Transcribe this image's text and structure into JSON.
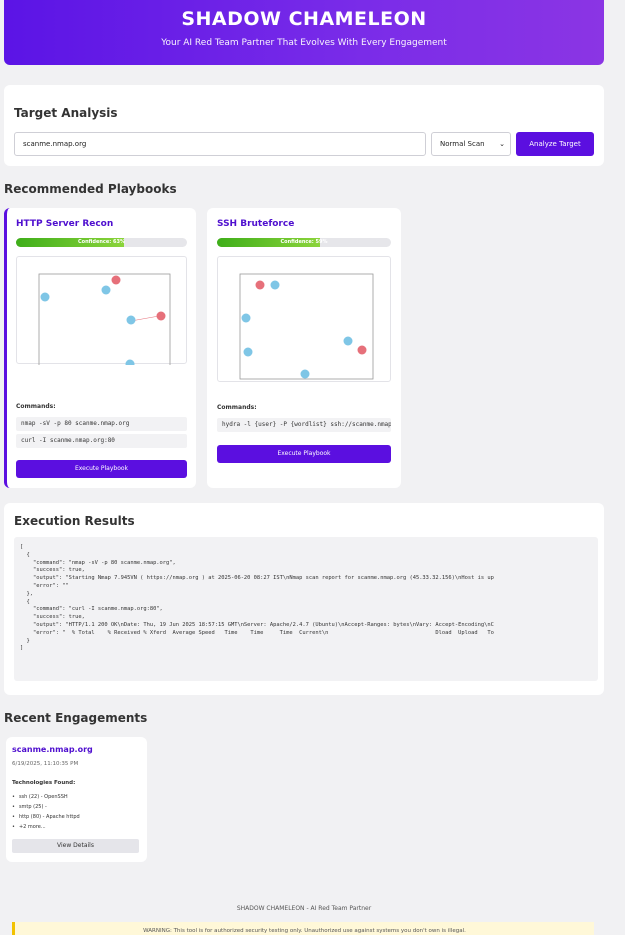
{
  "header": {
    "title": "SHADOW CHAMELEON",
    "subtitle": "Your AI Red Team Partner That Evolves With Every Engagement"
  },
  "target_analysis": {
    "title": "Target Analysis",
    "input_value": "scanme.nmap.org",
    "scan_type": "Normal Scan",
    "analyze_button": "Analyze Target"
  },
  "playbooks": {
    "title": "Recommended Playbooks",
    "items": [
      {
        "name": "HTTP Server Recon",
        "confidence_text": "Confidence: 63%",
        "confidence": 0.63,
        "commands_label": "Commands:",
        "commands": [
          "nmap -sV -p 80 scanme.nmap.org",
          "curl -I scanme.nmap.org:80"
        ],
        "button": "Execute Playbook"
      },
      {
        "name": "SSH Bruteforce",
        "confidence_text": "Confidence: 59%",
        "confidence": 0.59,
        "commands_label": "Commands:",
        "commands": [
          "hydra -l {user} -P {wordlist} ssh://scanme.nmap.org"
        ],
        "button": "Execute Playbook"
      }
    ]
  },
  "results": {
    "title": "Execution Results",
    "lines": [
      "[",
      "  {",
      "    \"command\": \"nmap -sV -p 80 scanme.nmap.org\",",
      "    \"success\": true,",
      "    \"output\": \"Starting Nmap 7.945VN ( https://nmap.org ) at 2025-06-20 08:27 IST\\nNmap scan report for scanme.nmap.org (45.33.32.156)\\nHost is up",
      "    \"error\": \"\"",
      "  },",
      "  {",
      "    \"command\": \"curl -I scanme.nmap.org:80\",",
      "    \"success\": true,",
      "    \"output\": \"HTTP/1.1 200 OK\\nDate: Thu, 19 Jun 2025 18:57:15 GMT\\nServer: Apache/2.4.7 (Ubuntu)\\nAccept-Ranges: bytes\\nVary: Accept-Encoding\\nC",
      "    \"error\": \"  % Total    % Received % Xferd  Average Speed   Time    Time     Time  Current\\n                                 Dload  Upload   To",
      "  }",
      "]"
    ]
  },
  "recent": {
    "title": "Recent Engagements",
    "engagement": {
      "host": "scanme.nmap.org",
      "date": "6/19/2025, 11:10:35 PM",
      "tech_label": "Technologies Found:",
      "technologies": [
        "ssh (22) - OpenSSH",
        "smtp (25) -",
        "http (80) - Apache httpd",
        "+2 more..."
      ],
      "button": "View Details"
    }
  },
  "footer": {
    "text": "SHADOW CHAMELEON - AI Red Team Partner",
    "warning": "WARNING: This tool is for authorized security testing only. Unauthorized use against systems you don't own is illegal."
  },
  "colors": {
    "brand": "#5b0fe0",
    "node_blue": "#7fc6e6",
    "node_red": "#e6707a"
  }
}
